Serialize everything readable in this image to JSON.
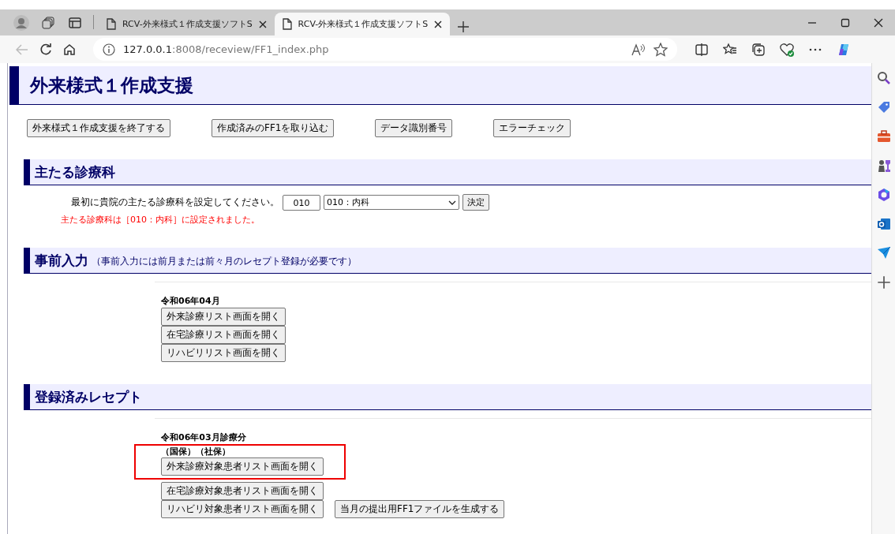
{
  "browser": {
    "tabs": [
      {
        "title": "RCV-外来様式１作成支援ソフトS",
        "selected": false
      },
      {
        "title": "RCV-外来様式１作成支援ソフトS",
        "selected": true
      }
    ],
    "address": {
      "host": "127.0.0.1",
      "rest": ":8008/receview/FF1_index.php"
    }
  },
  "page": {
    "title": "外来様式１作成支援",
    "top_buttons": [
      "外来様式１作成支援を終了する",
      "作成済みのFF1を取り込む",
      "データ識別番号",
      "エラーチェック"
    ],
    "sections": [
      {
        "kind": "department",
        "heading": "主たる診療科",
        "prompt": "最初に貴院の主たる診療科を設定してください。",
        "code": "010",
        "select": "010：内科",
        "button": "決定",
        "message": "主たる診療科は［010：内科］に設定されました。"
      },
      {
        "kind": "advance",
        "heading": "事前入力",
        "note": "（事前入力には前月または前々月のレセプト登録が必要です）",
        "period": "令和06年04月",
        "buttons": [
          "外来診療リスト画面を開く",
          "在宅診療リスト画面を開く",
          "リハビリリスト画面を開く"
        ]
      },
      {
        "kind": "registered",
        "heading": "登録済みレセプト",
        "period": "令和06年03月診療分",
        "insurers": "（国保）（社保）",
        "buttons": [
          "外来診療対象患者リスト画面を開く",
          "在宅診療対象患者リスト画面を開く",
          "リハビリ対象患者リスト画面を開く"
        ],
        "file_button": "当月の提出用FF1ファイルを生成する"
      }
    ]
  }
}
